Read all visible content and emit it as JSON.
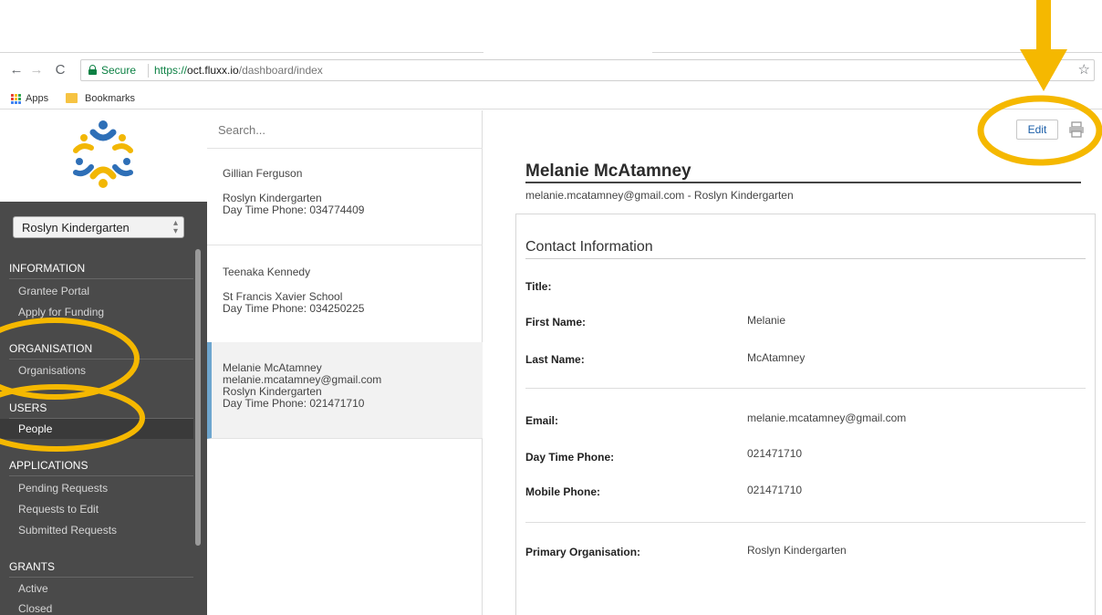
{
  "browser": {
    "url_protocol": "https://",
    "url_host": "oct.fluxx.io",
    "url_path": "/dashboard/index",
    "secure_label": "Secure",
    "bookmarks": [
      "Apps",
      "Bookmarks"
    ]
  },
  "sidebar": {
    "org_selector": "Roslyn Kindergarten",
    "sections": [
      {
        "heading": "INFORMATION",
        "items": [
          "Grantee Portal",
          "Apply for Funding"
        ]
      },
      {
        "heading": "ORGANISATION",
        "items": [
          "Organisations"
        ]
      },
      {
        "heading": "USERS",
        "items": [
          "People"
        ]
      },
      {
        "heading": "APPLICATIONS",
        "items": [
          "Pending Requests",
          "Requests to Edit",
          "Submitted Requests"
        ]
      },
      {
        "heading": "GRANTS",
        "items": [
          "Active",
          "Closed"
        ]
      }
    ],
    "active_item": "People"
  },
  "list": {
    "search_placeholder": "Search...",
    "people": [
      {
        "name": "Gillian Ferguson",
        "org": "Roslyn Kindergarten",
        "phone": "Day Time Phone: 034774409"
      },
      {
        "name": "Teenaka Kennedy",
        "org": "St Francis Xavier School",
        "phone": "Day Time Phone: 034250225"
      },
      {
        "name": "Melanie McAtamney",
        "email": "melanie.mcatamney@gmail.com",
        "org": "Roslyn Kindergarten",
        "phone": "Day Time Phone: 021471710"
      }
    ]
  },
  "detail": {
    "edit_label": "Edit",
    "name": "Melanie McAtamney",
    "subtitle": "melanie.mcatamney@gmail.com - Roslyn Kindergarten",
    "section_title": "Contact Information",
    "fields": [
      {
        "label": "Title:",
        "value": ""
      },
      {
        "label": "First Name:",
        "value": "Melanie"
      },
      {
        "label": "Last Name:",
        "value": "McAtamney"
      },
      {
        "label": "Email:",
        "value": "melanie.mcatamney@gmail.com"
      },
      {
        "label": "Day Time Phone:",
        "value": "021471710"
      },
      {
        "label": "Mobile Phone:",
        "value": "021471710"
      },
      {
        "label": "Primary Organisation:",
        "value": "Roslyn Kindergarten"
      }
    ]
  },
  "annotation_color": "#f5b800"
}
